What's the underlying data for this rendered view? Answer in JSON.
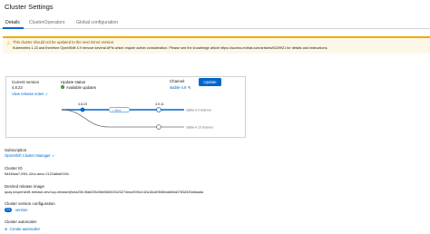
{
  "page": {
    "title": "Cluster Settings"
  },
  "tabs": [
    {
      "label": "Details"
    },
    {
      "label": "ClusterOperators"
    },
    {
      "label": "Global configuration"
    }
  ],
  "alert": {
    "title": "This cluster should not be updated to the next minor version.",
    "body": "Kubernetes 1.22 and therefore OpenShift 4.9 remove several APIs which require admin consideration. Please see the knowledge article https://access.redhat.com/articles/6329921 for details and instructions."
  },
  "current_version": {
    "label": "Current version",
    "value": "4.8.23",
    "link": "View release notes"
  },
  "update_status": {
    "label": "Update status",
    "value": "Available updates"
  },
  "channel": {
    "label": "Channel",
    "value": "stable-4.9"
  },
  "update_button": {
    "label": "Update"
  },
  "graph": {
    "node_current": "4.8.23",
    "node_next": "4.9.11",
    "more_label": "+ More",
    "lane_main": "stable-4.9 channel",
    "lane_next": "stable-4.10 channel"
  },
  "subscription": {
    "label": "Subscription",
    "value": "OpenShift Cluster Manager"
  },
  "cluster_id": {
    "label": "Cluster ID",
    "value": "5d446aa7-09f1-42cc-aecc-2122a8ad0184"
  },
  "release_image": {
    "label": "Desired release image",
    "value": "quay.io/openshift-release-dev/ocp-release@sha256:3fab205d36e566525423274eac90f4c142a18cdf358b4a666a0783d325a6aada"
  },
  "version_config": {
    "label": "Cluster version configuration",
    "value": "version"
  },
  "autoscaler": {
    "label": "Cluster autoscaler",
    "link": "Create autoscaler"
  },
  "colors": {
    "accent": "#0066cc",
    "warning": "#f0ab00",
    "success": "#3e8635"
  }
}
